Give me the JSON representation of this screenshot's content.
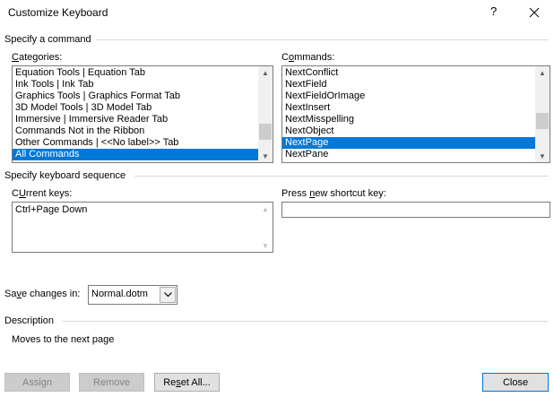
{
  "dialog": {
    "title": "Customize Keyboard",
    "help_glyph": "?"
  },
  "command_group": {
    "label": "Specify a command",
    "categories_label_u": "C",
    "categories_label_rest": "ategories:",
    "categories": [
      "Equation Tools | Equation Tab",
      "Ink Tools | Ink Tab",
      "Graphics Tools | Graphics Format Tab",
      "3D Model Tools | 3D Model Tab",
      "Immersive | Immersive Reader Tab",
      "Commands Not in the Ribbon",
      "Other Commands | <<No label>> Tab",
      "All Commands"
    ],
    "categories_selected": "All Commands",
    "commands_label_pre": "C",
    "commands_label_u": "o",
    "commands_label_rest": "mmands:",
    "commands": [
      "NextConflict",
      "NextField",
      "NextFieldOrImage",
      "NextInsert",
      "NextMisspelling",
      "NextObject",
      "NextPage",
      "NextPane"
    ],
    "commands_selected": "NextPage"
  },
  "keyboard_group": {
    "label": "Specify keyboard sequence",
    "current_keys_label_u": "U",
    "current_keys_label_pre": "C",
    "current_keys_label_rest": "rrent keys:",
    "current_keys": [
      "Ctrl+Page Down"
    ],
    "new_key_label_pre": "Press ",
    "new_key_label_u": "n",
    "new_key_label_rest": "ew shortcut key:",
    "new_key_value": ""
  },
  "save": {
    "label_pre": "Sa",
    "label_u": "v",
    "label_rest": "e changes in:",
    "value": "Normal.dotm"
  },
  "description": {
    "label": "Description",
    "text": "Moves to the next page"
  },
  "buttons": {
    "assign": "Assign",
    "remove": "Remove",
    "reset_pre": "Re",
    "reset_u": "s",
    "reset_rest": "et All...",
    "close": "Close"
  },
  "colors": {
    "selection": "#0078d7",
    "default_button_border": "#0078d7"
  }
}
